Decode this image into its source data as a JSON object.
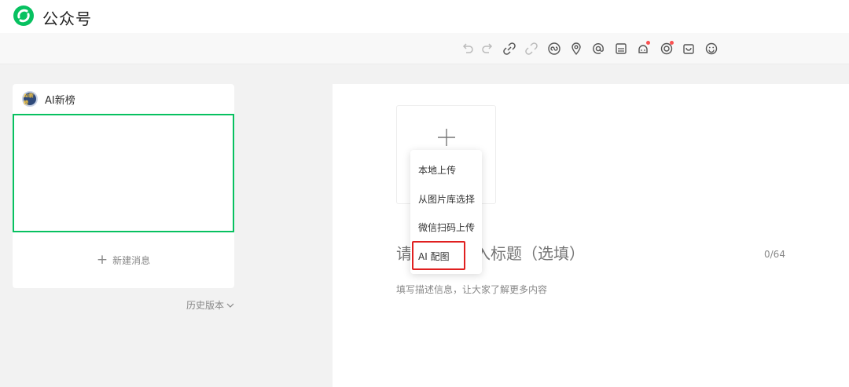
{
  "header": {
    "brand": "公众号",
    "logo_icon": "wechat-official-logo-icon",
    "accent": "#07c160"
  },
  "toolbar": {
    "icons": [
      "undo-icon",
      "redo-icon",
      "link-icon",
      "unlink-icon",
      "mini-program-icon",
      "location-icon",
      "mention-icon",
      "image-text-icon",
      "video-icon",
      "audio-icon",
      "product-icon",
      "emoji-icon"
    ]
  },
  "sidebar": {
    "account": {
      "name": "AI新榜",
      "avatar_text": "AI新榜"
    },
    "new_message_label": "新建消息",
    "history_label": "历史版本"
  },
  "editor": {
    "cover_plus_icon": "plus-icon",
    "title_placeholder": "请在这里输入标题（选填）",
    "title_counter": "0/64",
    "description_placeholder": "填写描述信息，让大家了解更多内容"
  },
  "cover_menu": {
    "items": [
      "本地上传",
      "从图片库选择",
      "微信扫码上传",
      "AI 配图"
    ],
    "highlighted_item": "AI 配图",
    "highlight_color": "#e02020"
  }
}
